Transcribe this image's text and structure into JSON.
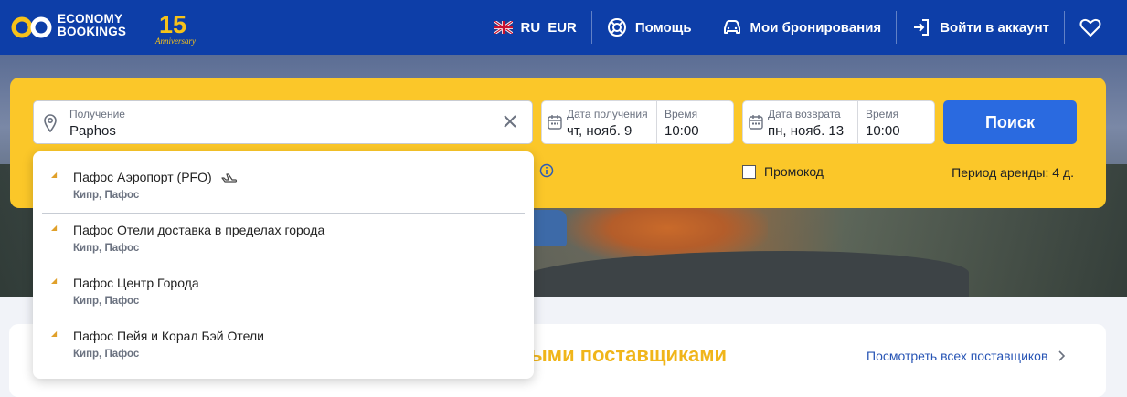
{
  "brand": {
    "line1": "ECONOMY",
    "line2": "BOOKINGS",
    "anniversary_number": "15",
    "anniversary_word": "Anniversary"
  },
  "nav": {
    "language": "RU",
    "currency": "EUR",
    "help": "Помощь",
    "bookings": "Мои бронирования",
    "login": "Войти в аккаунт"
  },
  "search": {
    "pickup_label": "Получение",
    "pickup_value": "Paphos",
    "pickup_date_label": "Дата получения",
    "pickup_date": "чт, нояб. 9",
    "pickup_time_label": "Время",
    "pickup_time": "10:00",
    "return_date_label": "Дата возврата",
    "return_date": "пн, нояб. 13",
    "return_time_label": "Время",
    "return_time": "10:00",
    "button": "Поиск",
    "promo": "Промокод",
    "period": "Период аренды: 4 д."
  },
  "suggestions": [
    {
      "title": "Пафос Аэропорт (PFO)",
      "subtitle": "Кипр, Пафос",
      "icon": "plane-icon"
    },
    {
      "title": "Пафос Отели доставка в пределах города",
      "subtitle": "Кипр, Пафос"
    },
    {
      "title": "Пафос Центр Города",
      "subtitle": "Кипр, Пафос"
    },
    {
      "title": "Пафос Пейя и Корал Бэй Отели",
      "subtitle": "Кипр, Пафос"
    }
  ],
  "suppliers": {
    "title_visible": "ыми поставщиками",
    "all_link": "Посмотреть всех поставщиков"
  },
  "colors": {
    "header": "#0d3ea8",
    "panel": "#fbc729",
    "search_button": "#2a6ae0",
    "accent_yellow": "#f0b51a"
  }
}
